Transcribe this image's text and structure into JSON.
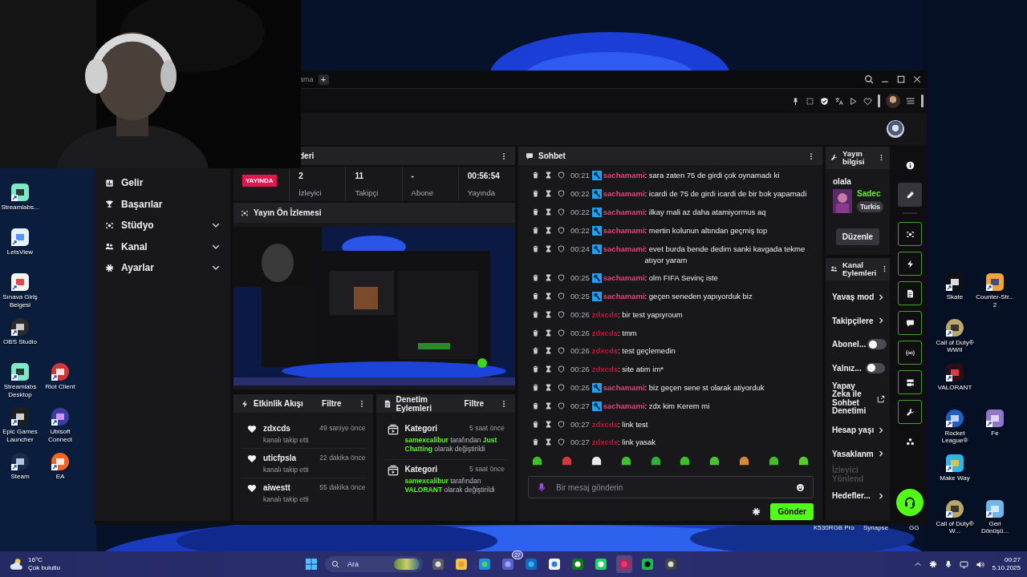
{
  "desktop": {
    "left_column": [
      {
        "label": "Streamlabs...",
        "kind": "streamlabs"
      },
      {
        "label": "LetsView",
        "kind": "letsview"
      },
      {
        "label": "Sınava Giriş Belgesi",
        "kind": "pdf"
      },
      {
        "label": "OBS Studio",
        "kind": "obs"
      },
      {
        "label": "Streamlabs Desktop",
        "kind": "streamlabs"
      },
      {
        "label": "Epic Games Launcher",
        "kind": "epic"
      },
      {
        "label": "Steam",
        "kind": "steam"
      }
    ],
    "left_second_column": [
      {
        "label": "Riot Client",
        "kind": "riot"
      },
      {
        "label": "Ubisoft Connect",
        "kind": "ubisoft"
      },
      {
        "label": "EA",
        "kind": "ea"
      }
    ],
    "right_column": [
      {
        "label": "Skate",
        "kind": "skate"
      },
      {
        "label": "Call of Duty® WWII",
        "kind": "cod"
      },
      {
        "label": "VALORANT",
        "kind": "valorant"
      },
      {
        "label": "Rocket League®",
        "kind": "rocket"
      },
      {
        "label": "Make Way",
        "kind": "makeway"
      },
      {
        "label": "Call of Duty® W...",
        "kind": "cod"
      }
    ],
    "right_second_column": [
      {
        "label": "Counter-Str... 2",
        "kind": "cs"
      },
      {
        "label": "Fe",
        "kind": "fe"
      },
      {
        "label": "Geri Dönüşü...",
        "kind": "recycle"
      }
    ],
    "hidden_icon_labels": [
      "K530RGB Pro",
      "Synapse",
      "GG"
    ]
  },
  "browser": {
    "tab_title": "ama",
    "new_tab": "+"
  },
  "nav": [
    {
      "label": "Gelir",
      "kind": "link"
    },
    {
      "label": "Başarılar",
      "kind": "link"
    },
    {
      "label": "Stüdyo",
      "kind": "group"
    },
    {
      "label": "Kanal",
      "kind": "group"
    },
    {
      "label": "Ayarlar",
      "kind": "group"
    }
  ],
  "stats": {
    "title": "deri",
    "live_badge": "YAYINDA",
    "items": [
      {
        "value": "2",
        "label": "İzleyici"
      },
      {
        "value": "11",
        "label": "Takipçi"
      },
      {
        "value": "-",
        "label": "Abone"
      },
      {
        "value": "00:56:54",
        "label": "Yayında"
      }
    ]
  },
  "preview": {
    "title": "Yayın Ön İzlemesi"
  },
  "activity": {
    "title": "Etkinlik Akışı",
    "filter": "Filtre",
    "events": [
      {
        "user": "zdxcds",
        "action": "kanalı takip etti",
        "time": "49 saniye önce"
      },
      {
        "user": "uticfpsla",
        "action": "kanalı takip etti",
        "time": "22 dakika önce"
      },
      {
        "user": "aiwestt",
        "action": "kanalı takip etti",
        "time": "55 dakika önce"
      }
    ]
  },
  "moderation": {
    "title": "Denetim Eylemleri",
    "filter": "Filtre",
    "actions": [
      {
        "title": "Kategori",
        "time": "5 saat önce",
        "text": "**samexcalibur** tarafından **Just Chatting** olarak değiştirildi"
      },
      {
        "title": "Kategori",
        "time": "5 saat önce",
        "text": "**samexcalibur** tarafından **VALORANT** olarak değiştirildi"
      }
    ]
  },
  "chat": {
    "title": "Sohbet",
    "messages": [
      {
        "time": "00:21",
        "user": "sachamami",
        "color": "#e8407a",
        "badge": true,
        "text": ": sara zaten 75 de girdi çok oynamadı ki"
      },
      {
        "time": "00:22",
        "user": "sachamami",
        "color": "#e8407a",
        "badge": true,
        "text": ": icardi de 75 de girdi icardi de bir bok yapamadi"
      },
      {
        "time": "00:22",
        "user": "sachamami",
        "color": "#e8407a",
        "badge": true,
        "text": ": ilkay mali az daha atamiyormus aq"
      },
      {
        "time": "00:22",
        "user": "sachamami",
        "color": "#e8407a",
        "badge": true,
        "text": ": mertin kolunun altından geçmiş top"
      },
      {
        "time": "00:24",
        "user": "sachamami",
        "color": "#e8407a",
        "badge": true,
        "text": ": evet burda bende dedim sanki kavgada tekme atıyor yaram"
      },
      {
        "time": "00:25",
        "user": "sachamami",
        "color": "#e8407a",
        "badge": true,
        "text": ": olm FIFA Sevinç iste"
      },
      {
        "time": "00:25",
        "user": "sachamami",
        "color": "#e8407a",
        "badge": true,
        "text": ": geçen seneden yapıyorduk biz"
      },
      {
        "time": "00:26",
        "user": "zdxcds",
        "color": "#c8143c",
        "badge": false,
        "text": ": bir test yapıyroum"
      },
      {
        "time": "00:26",
        "user": "zdxcds",
        "color": "#c8143c",
        "badge": false,
        "text": ": tmm"
      },
      {
        "time": "00:26",
        "user": "zdxcds",
        "color": "#c8143c",
        "badge": false,
        "text": ": test geçlemedin"
      },
      {
        "time": "00:26",
        "user": "zdxcds",
        "color": "#c8143c",
        "badge": false,
        "text": ": site atim im*"
      },
      {
        "time": "00:26",
        "user": "sachamami",
        "color": "#e8407a",
        "badge": true,
        "text": ": biz geçen sene st olarak atiyorduk"
      },
      {
        "time": "00:27",
        "user": "sachamami",
        "color": "#e8407a",
        "badge": true,
        "text": ": zdx kim Kerem mi"
      },
      {
        "time": "00:27",
        "user": "zdxcds",
        "color": "#c8143c",
        "badge": false,
        "text": ": link test"
      },
      {
        "time": "00:27",
        "user": "zdxcds",
        "color": "#c8143c",
        "badge": false,
        "text": ": link yasak"
      }
    ],
    "emotes": [
      {
        "color": "#3fbf2a"
      },
      {
        "color": "#d23a3a"
      },
      {
        "color": "#e8e8e8"
      },
      {
        "color": "#3fbf2a"
      },
      {
        "color": "#2fae3a"
      },
      {
        "color": "#3fbf2a"
      },
      {
        "color": "#45c42e"
      },
      {
        "color": "#d8883a"
      },
      {
        "color": "#3fbf2a"
      },
      {
        "color": "#5acb2a"
      }
    ],
    "input": {
      "placeholder": "Bir mesaj gönderin"
    },
    "send": "Gönder"
  },
  "stream_info": {
    "title": "Yayın bilgisi",
    "stream_title": "olala",
    "category": "Sadec",
    "tag": "Turkis",
    "edit": "Düzenle"
  },
  "channel_actions": {
    "title": "Kanal Eylemleri",
    "items": [
      {
        "kind": "link",
        "label": "Yavaş mod",
        "disabled": false
      },
      {
        "kind": "link",
        "label": "Takipçilere",
        "disabled": false
      },
      {
        "kind": "toggle",
        "label": "Abonel...",
        "on": false,
        "disabled": false
      },
      {
        "kind": "toggle",
        "label": "Yalnız...",
        "on": false,
        "disabled": false
      },
      {
        "kind": "external",
        "label": "Yapay Zeka ile Sohbet Denetimi",
        "disabled": false
      },
      {
        "kind": "link",
        "label": "Hesap yaşı",
        "disabled": false
      },
      {
        "kind": "link",
        "label": "Yasaklanm",
        "disabled": false
      },
      {
        "kind": "plain",
        "label": "İzleyici Yönlend",
        "disabled": true
      },
      {
        "kind": "link",
        "label": "Hedefler...",
        "disabled": false
      }
    ]
  },
  "rail": [
    {
      "kind": "info",
      "selected": false,
      "pinned": false
    },
    {
      "kind": "pencil",
      "selected": true,
      "pinned": false
    },
    {
      "kind": "studio",
      "selected": false,
      "pinned": true
    },
    {
      "kind": "bolt",
      "selected": false,
      "pinned": true
    },
    {
      "kind": "doc",
      "selected": false,
      "pinned": true
    },
    {
      "kind": "chat",
      "selected": false,
      "pinned": true
    },
    {
      "kind": "broadcast",
      "selected": false,
      "pinned": true
    },
    {
      "kind": "camera",
      "selected": false,
      "pinned": true
    },
    {
      "kind": "wrench",
      "selected": false,
      "pinned": true
    },
    {
      "kind": "dots",
      "selected": false,
      "pinned": false
    }
  ],
  "taskbar": {
    "weather": {
      "temperature": "16°C",
      "text": "Çok bulutlu"
    },
    "search": {
      "placeholder": "Ara"
    },
    "apps": [
      {
        "kind": "calculator",
        "active": false
      },
      {
        "kind": "folder",
        "active": false
      },
      {
        "kind": "edge",
        "active": false
      },
      {
        "kind": "teams",
        "active": false,
        "badge": "27"
      },
      {
        "kind": "outlook",
        "active": false
      },
      {
        "kind": "store",
        "active": false
      },
      {
        "kind": "xbox",
        "active": false
      },
      {
        "kind": "whatsapp",
        "active": false
      },
      {
        "kind": "ring",
        "active": true
      },
      {
        "kind": "spotify",
        "active": false
      },
      {
        "kind": "record",
        "active": false
      }
    ],
    "clock": {
      "time": "00:27",
      "date": "5.10.2025"
    }
  }
}
